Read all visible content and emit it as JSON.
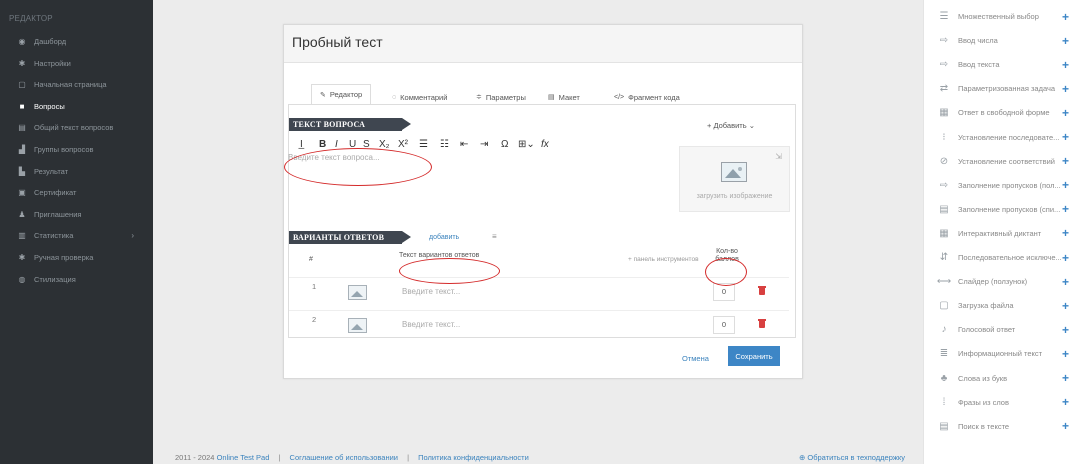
{
  "sidebar": {
    "title": "РЕДАКТОР",
    "items": [
      {
        "icon": "dashboard-icon",
        "glyph": "◉",
        "label": "Дашборд"
      },
      {
        "icon": "gear-icon",
        "glyph": "✱",
        "label": "Настройки"
      },
      {
        "icon": "page-icon",
        "glyph": "▢",
        "label": "Начальная страница"
      },
      {
        "icon": "questions-icon",
        "glyph": "■",
        "label": "Вопросы",
        "active": true
      },
      {
        "icon": "text-icon",
        "glyph": "▤",
        "label": "Общий текст вопросов"
      },
      {
        "icon": "groups-icon",
        "glyph": "▟",
        "label": "Группы вопросов"
      },
      {
        "icon": "results-icon",
        "glyph": "▙",
        "label": "Результат"
      },
      {
        "icon": "certificate-icon",
        "glyph": "▣",
        "label": "Сертификат"
      },
      {
        "icon": "invitations-icon",
        "glyph": "♟",
        "label": "Приглашения"
      },
      {
        "icon": "statistics-icon",
        "glyph": "▥",
        "label": "Статистика",
        "arrow": "›"
      },
      {
        "icon": "check-icon",
        "glyph": "✱",
        "label": "Ручная проверка"
      },
      {
        "icon": "style-icon",
        "glyph": "◍",
        "label": "Стилизация"
      }
    ]
  },
  "modal": {
    "title": "Пробный тест",
    "tabs": [
      {
        "icon": "edit-icon",
        "glyph": "✎",
        "label": "Редактор",
        "active": true
      },
      {
        "icon": "comment-icon",
        "glyph": "◌",
        "label": "Комментарий"
      },
      {
        "icon": "params-icon",
        "glyph": "≑",
        "label": "Параметры"
      },
      {
        "icon": "layout-icon",
        "glyph": "▤",
        "label": "Макет"
      },
      {
        "icon": "code-icon",
        "glyph": "</>",
        "label": "Фрагмент кода"
      }
    ],
    "question_header": "ТЕКСТ ВОПРОСА",
    "add_label": "+ Добавить ⌄",
    "question_placeholder": "Введите текст вопроса...",
    "upload_label": "загрузить изображение",
    "answers_header": "ВАРИАНТЫ ОТВЕТОВ",
    "answers_add": "добавить",
    "answers_menu": "≡",
    "columns": {
      "num": "#",
      "text": "Текст вариантов ответов",
      "toolbar": "+ панель инструментов",
      "score": "Кол-во баллов"
    },
    "answers": [
      {
        "num": "1",
        "placeholder": "Введите текст...",
        "score": "0"
      },
      {
        "num": "2",
        "placeholder": "Введите текст...",
        "score": "0"
      }
    ],
    "cancel": "Отмена",
    "save": "Сохранить"
  },
  "toolbar": [
    "I̲",
    "B",
    "I",
    "U",
    "S",
    "X₂",
    "X²",
    "☰",
    "☷",
    "⇤",
    "⇥",
    "Ω",
    "⊞⌄",
    "fx"
  ],
  "right_panel": [
    {
      "icon": "multiple-choice-icon",
      "glyph": "☰",
      "label": "Множественный выбор"
    },
    {
      "icon": "number-input-icon",
      "glyph": "⇨",
      "label": "Ввод числа"
    },
    {
      "icon": "text-input-icon",
      "glyph": "⇨",
      "label": "Ввод текста"
    },
    {
      "icon": "param-task-icon",
      "glyph": "⇄",
      "label": "Параметризованная задача"
    },
    {
      "icon": "free-answer-icon",
      "glyph": "▦",
      "label": "Ответ в свободной форме"
    },
    {
      "icon": "sequence-icon",
      "glyph": "⁝",
      "label": "Установление последовате..."
    },
    {
      "icon": "match-icon",
      "glyph": "⊘",
      "label": "Установление соответствий"
    },
    {
      "icon": "gaps-list-icon",
      "glyph": "⇨",
      "label": "Заполнение пропусков (пол..."
    },
    {
      "icon": "gaps-select-icon",
      "glyph": "▤",
      "label": "Заполнение пропусков (спи..."
    },
    {
      "icon": "dictation-icon",
      "glyph": "▦",
      "label": "Интерактивный диктант"
    },
    {
      "icon": "exclusion-icon",
      "glyph": "⇵",
      "label": "Последовательное исключе..."
    },
    {
      "icon": "slider-icon",
      "glyph": "⟷",
      "label": "Слайдер (ползунок)"
    },
    {
      "icon": "file-upload-icon",
      "glyph": "▢",
      "label": "Загрузка файла"
    },
    {
      "icon": "voice-icon",
      "glyph": "♪",
      "label": "Голосовой ответ"
    },
    {
      "icon": "info-text-icon",
      "glyph": "≣",
      "label": "Информационный текст"
    },
    {
      "icon": "words-icon",
      "glyph": "♣",
      "label": "Слова из букв"
    },
    {
      "icon": "phrases-icon",
      "glyph": "⁞",
      "label": "Фразы из слов"
    },
    {
      "icon": "search-text-icon",
      "glyph": "▤",
      "label": "Поиск в тексте"
    }
  ],
  "footer": {
    "copyright": "2011 - 2024",
    "brand": "Online Test Pad",
    "agreement": "Соглашение об использовании",
    "privacy": "Политика конфиденциальности",
    "support": "⊕ Обратиться в техподдержку"
  }
}
